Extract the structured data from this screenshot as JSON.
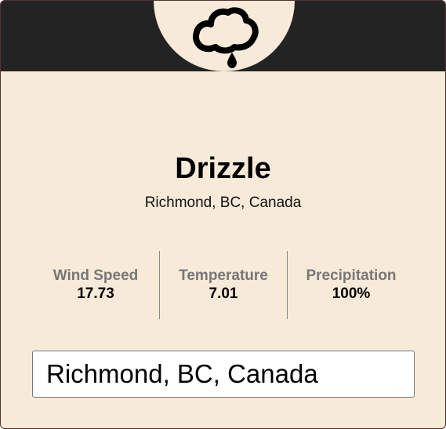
{
  "weather": {
    "icon": "drizzle-cloud-icon",
    "condition": "Drizzle",
    "location": "Richmond, BC, Canada"
  },
  "stats": [
    {
      "label": "Wind Speed",
      "value": "17.73"
    },
    {
      "label": "Temperature",
      "value": "7.01"
    },
    {
      "label": "Precipitation",
      "value": "100%"
    }
  ],
  "search": {
    "value": "Richmond, BC, Canada"
  },
  "colors": {
    "header": "#232323",
    "card_background": "#f8ead8",
    "label_gray": "#777777"
  }
}
